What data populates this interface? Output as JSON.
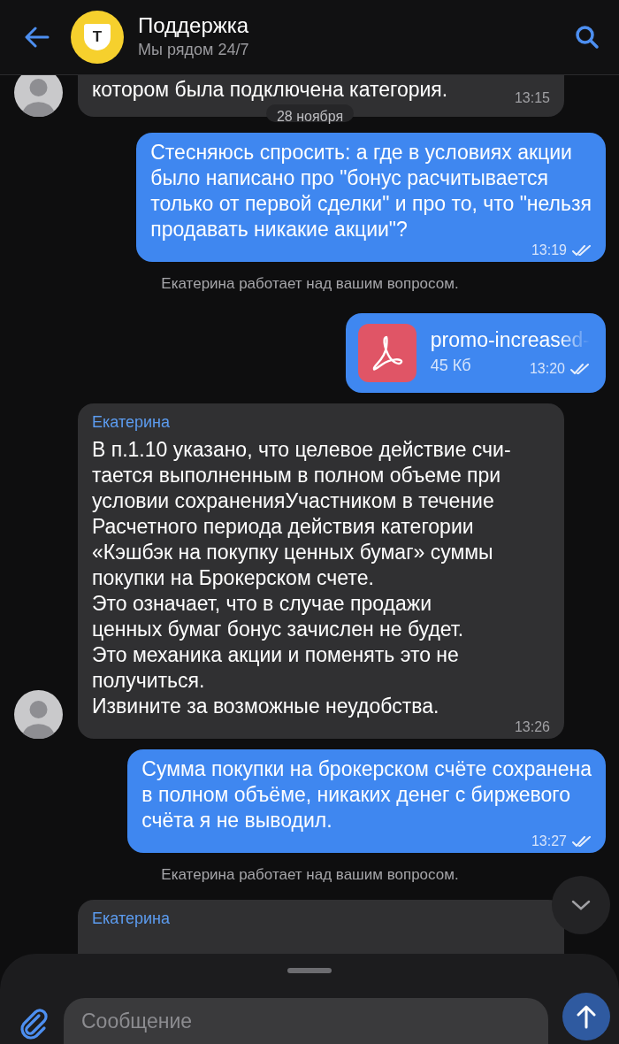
{
  "header": {
    "title": "Поддержка",
    "subtitle": "Мы рядом 24/7",
    "logo_text": "T"
  },
  "messages": [
    {
      "kind": "incoming",
      "text": "котором была подключена категория.",
      "time": "13:15",
      "avatar": true
    },
    {
      "kind": "date",
      "text": "28 ноября"
    },
    {
      "kind": "outgoing",
      "text": "Стесняюсь спросить: а где в условиях акции\nбыло написано про \"бонус расчитывается\nтолько от первой сделки\" и про то, что \"нельзя\nпродавать никакие акции\"?",
      "time": "13:19",
      "read": true
    },
    {
      "kind": "status",
      "text": "Екатерина работает над вашим вопросом."
    },
    {
      "kind": "file",
      "filename": "promo-increased-",
      "size": "45 Кб",
      "time": "13:20",
      "read": true
    },
    {
      "kind": "incoming",
      "sender": "Екатерина",
      "text": "В п.1.10 указано, что целевое действие счи-\nтается выполненным в полном объеме при\nусловии сохраненияУчастником в течение\nРасчетного периода действия категории\n«Кэшбэк на покупку ценных бумаг» суммы\nпокупки на Брокерском счете.\nЭто означает, что в случае продажи\nценных бумаг бонус зачислен не будет.\nЭто механика акции и поменять это не\nполучиться.\nИзвините за возможные неудобства.",
      "time": "13:26",
      "avatar": true
    },
    {
      "kind": "outgoing",
      "text": "Сумма покупки на брокерском счёте сохранена\nв полном объёме, никаких денег с биржевого\nсчёта я не выводил.",
      "time": "13:27",
      "read": true
    },
    {
      "kind": "status",
      "text": "Екатерина работает над вашим вопросом."
    },
    {
      "kind": "incoming",
      "sender": "Екатерина",
      "avatar": false
    }
  ],
  "composer": {
    "placeholder": "Сообщение"
  }
}
